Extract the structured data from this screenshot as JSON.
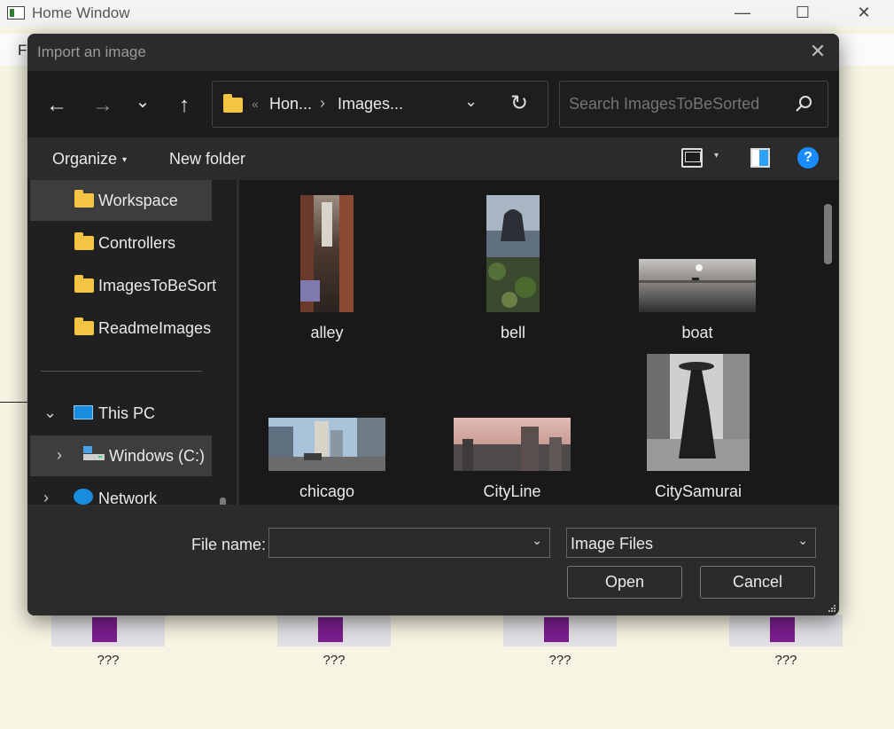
{
  "app_window": {
    "title": "Home Window",
    "menu_first_letter": "F",
    "tile_labels": [
      "???",
      "???",
      "???",
      "???"
    ],
    "tile_color": "#7b1d8e",
    "controls": {
      "minimize": "—",
      "maximize": "☐",
      "close": "✕"
    }
  },
  "dialog": {
    "title": "Import an image",
    "close": "✕"
  },
  "navigation": {
    "back": "←",
    "forward": "→",
    "recent": "⌄",
    "up": "↑",
    "breadcrumb_overflow": "«",
    "breadcrumb": [
      "Hon...",
      "Images..."
    ],
    "breadcrumb_sep": "›",
    "refresh": "↻",
    "dropdown": "⌄"
  },
  "search": {
    "placeholder": "Search ImagesToBeSorted"
  },
  "commands": {
    "organize": "Organize",
    "organize_caret": "▾",
    "new_folder": "New folder",
    "view_caret": "▾",
    "help": "?"
  },
  "sidebar": {
    "folders": [
      {
        "label": "Workspace",
        "selected": true
      },
      {
        "label": "Controllers",
        "selected": false
      },
      {
        "label": "ImagesToBeSort",
        "selected": false
      },
      {
        "label": "ReadmeImages",
        "selected": false
      }
    ],
    "this_pc": {
      "label": "This PC",
      "expander": "⌄"
    },
    "drive": {
      "label": "Windows (C:)",
      "expander": "›"
    },
    "network": {
      "label": "Network",
      "expander": "›"
    }
  },
  "files": [
    {
      "name": "alley"
    },
    {
      "name": "bell"
    },
    {
      "name": "boat"
    },
    {
      "name": "chicago"
    },
    {
      "name": "CityLine"
    },
    {
      "name": "CitySamurai"
    }
  ],
  "footer": {
    "file_name_label": "File name:",
    "file_name_value": "",
    "file_type": "Image Files",
    "chevron": "⌄",
    "open": "Open",
    "cancel": "Cancel"
  },
  "colors": {
    "folder": "#f4c542",
    "accent": "#1a8cff",
    "dialog_bg": "#202020",
    "app_bg": "#f6f5e3"
  }
}
